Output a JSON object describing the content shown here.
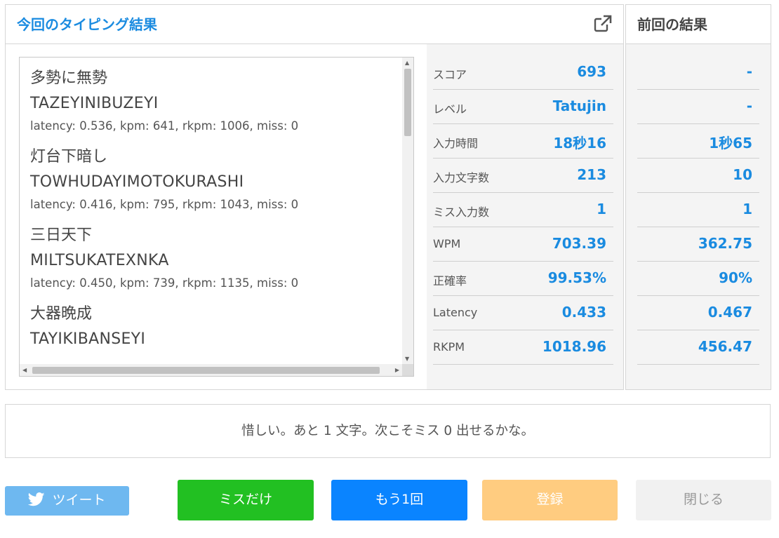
{
  "current": {
    "title": "今回のタイピング結果",
    "words": [
      {
        "jp": "多勢に無勢",
        "romaji": "TAZEYINIBUZEYI",
        "stats": "latency: 0.536, kpm: 641, rkpm: 1006, miss: 0"
      },
      {
        "jp": "灯台下暗し",
        "romaji": "TOWHUDAYIMOTOKURASHI",
        "stats": "latency: 0.416, kpm: 795, rkpm: 1043, miss: 0"
      },
      {
        "jp": "三日天下",
        "romaji": "MILTSUKATEXNKA",
        "stats": "latency: 0.450, kpm: 739, rkpm: 1135, miss: 0"
      },
      {
        "jp": "大器晩成",
        "romaji": "TAYIKIBANSEYI",
        "stats": ""
      }
    ],
    "stats": [
      {
        "label": "スコア",
        "value": "693"
      },
      {
        "label": "レベル",
        "value": "Tatujin"
      },
      {
        "label": "入力時間",
        "value": "18秒16"
      },
      {
        "label": "入力文字数",
        "value": "213"
      },
      {
        "label": "ミス入力数",
        "value": "1"
      },
      {
        "label": "WPM",
        "value": "703.39"
      },
      {
        "label": "正確率",
        "value": "99.53%"
      },
      {
        "label": "Latency",
        "value": "0.433"
      },
      {
        "label": "RKPM",
        "value": "1018.96"
      }
    ]
  },
  "previous": {
    "title": "前回の結果",
    "values": [
      "-",
      "-",
      "1秒65",
      "10",
      "1",
      "362.75",
      "90%",
      "0.467",
      "456.47"
    ]
  },
  "message": "惜しい。あと 1 文字。次こそミス 0 出せるかな。",
  "buttons": {
    "tweet": "ツイート",
    "miss_only": "ミスだけ",
    "retry": "もう1回",
    "register": "登録",
    "close": "閉じる"
  },
  "colors": {
    "accent_blue": "#1a8be0",
    "tweet": "#55acee",
    "miss_only": "#22c022",
    "retry": "#0a84ff",
    "register": "#ffcc80",
    "close": "#f1f1f1"
  },
  "icons": {
    "external_link": "external-link-icon",
    "twitter": "twitter-bird-icon"
  }
}
